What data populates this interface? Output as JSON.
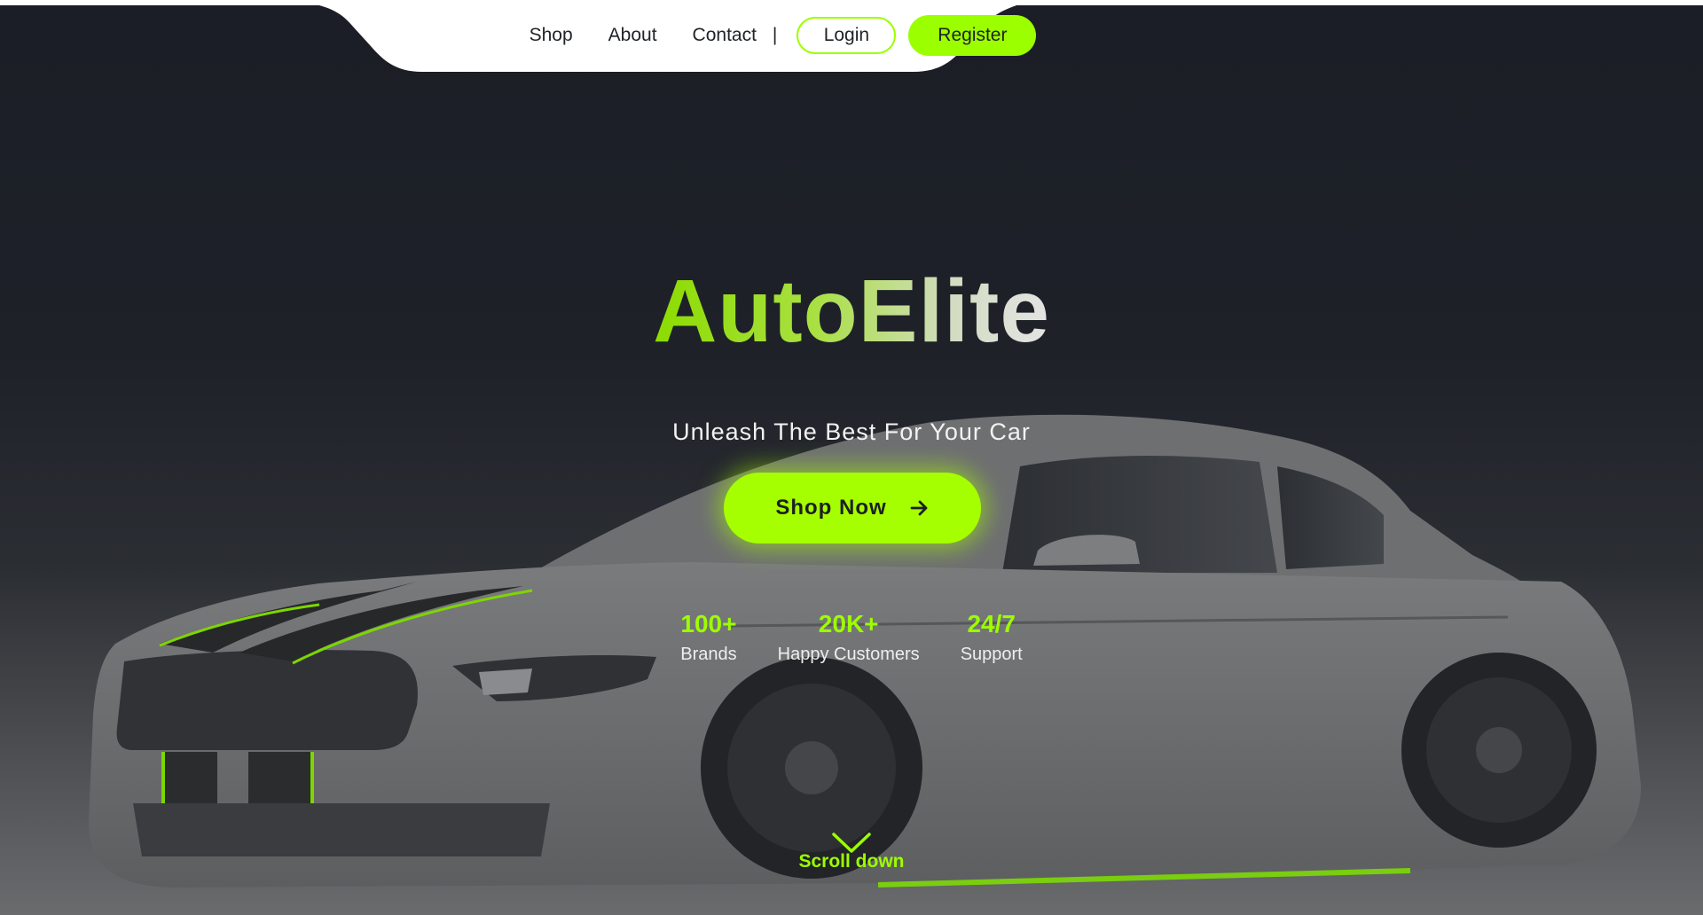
{
  "nav": {
    "links": [
      "Shop",
      "About",
      "Contact"
    ],
    "separator": "|",
    "login_label": "Login",
    "register_label": "Register"
  },
  "hero": {
    "title": "AutoElite",
    "subtitle": "Unleash The Best For Your Car",
    "cta_label": "Shop Now",
    "cta_icon": "arrow-right-icon"
  },
  "stats": [
    {
      "value": "100+",
      "label": "Brands"
    },
    {
      "value": "20K+",
      "label": "Happy Customers"
    },
    {
      "value": "24/7",
      "label": "Support"
    }
  ],
  "scroll": {
    "label": "Scroll down",
    "icon": "chevron-down-icon"
  },
  "colors": {
    "accent": "#9cff00",
    "background_top": "#1b1e26",
    "background_bottom": "#6a6b6d",
    "nav_background": "#ffffff",
    "text_dark": "#1f2226"
  }
}
